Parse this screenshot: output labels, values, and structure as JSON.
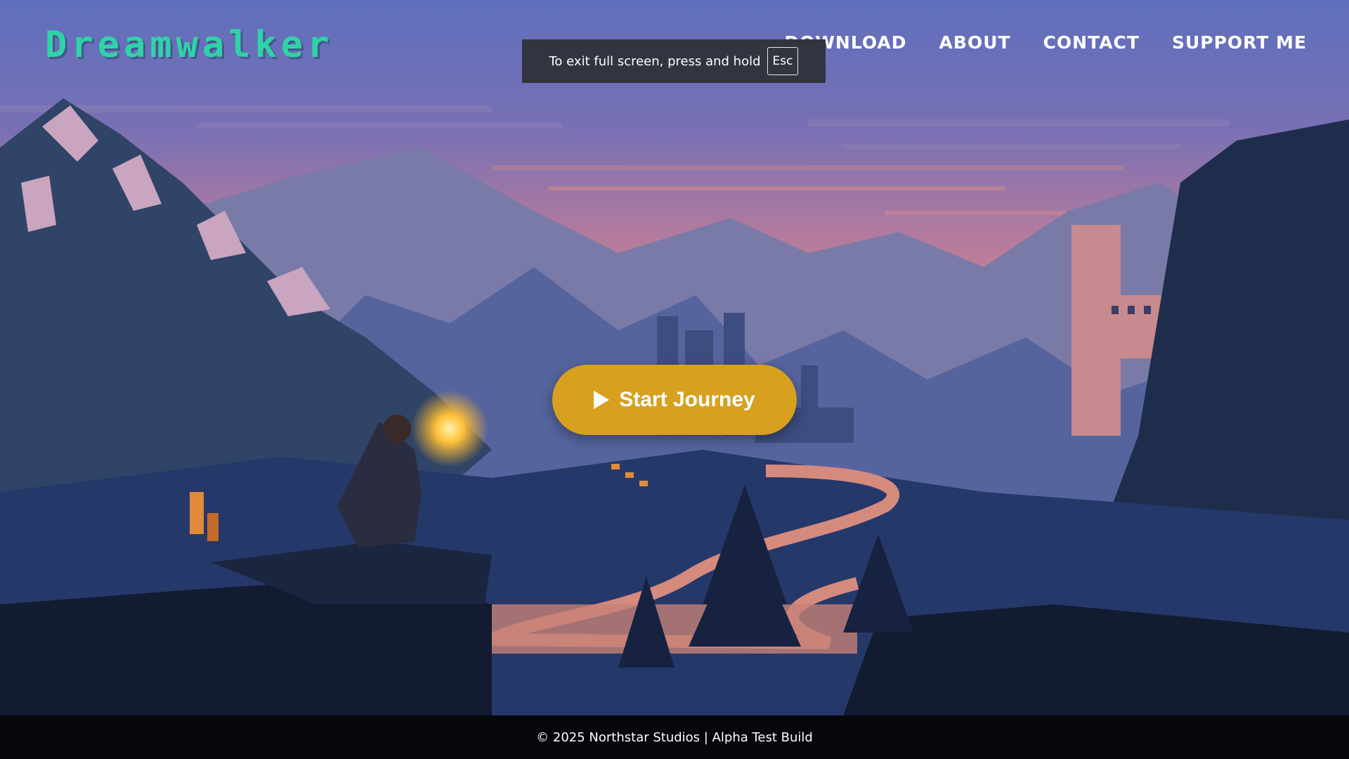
{
  "brand": {
    "name": "Dreamwalker"
  },
  "nav": {
    "items": [
      {
        "label": "DOWNLOAD"
      },
      {
        "label": "ABOUT"
      },
      {
        "label": "CONTACT"
      },
      {
        "label": "SUPPORT ME"
      }
    ]
  },
  "fullscreen_notice": {
    "text": "To exit full screen, press and hold",
    "key": "Esc"
  },
  "hero": {
    "cta_label": "Start Journey",
    "cta_icon": "play-icon"
  },
  "footer": {
    "text": "© 2025 Northstar Studios | Alpha Test Build"
  },
  "colors": {
    "brand": "#2fd4a6",
    "cta": "#d7a11f",
    "sky_top": "#5f6fbd",
    "sky_glow": "#c87a92",
    "footer_bg": "#05070b"
  }
}
